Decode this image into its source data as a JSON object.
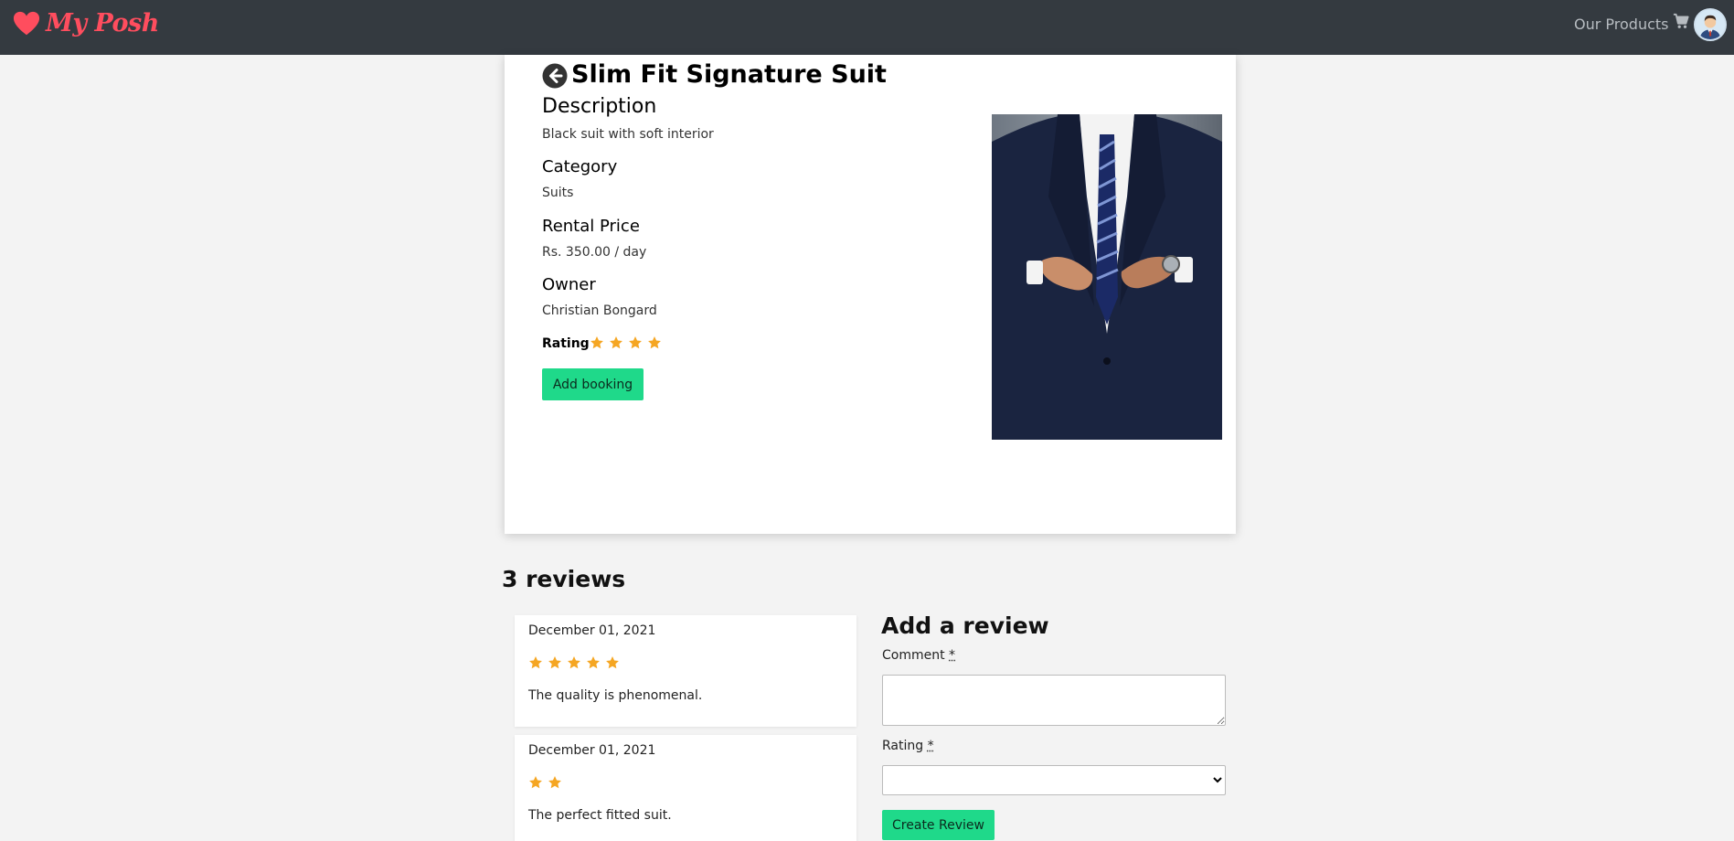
{
  "navbar": {
    "brand": "My Posh",
    "brand_color": "#ff4d5e",
    "links": [
      {
        "label": "Our Products"
      }
    ],
    "icons": [
      "heart-icon",
      "cart-icon",
      "user-avatar"
    ]
  },
  "product": {
    "title": "Slim Fit Signature Suit",
    "description_heading": "Description",
    "description": "Black suit with soft interior",
    "category_heading": "Category",
    "category": "Suits",
    "price_heading": "Rental Price",
    "price": "Rs. 350.00 / day",
    "owner_heading": "Owner",
    "owner": "Christian Bongard",
    "rating_label": "Rating",
    "rating": 4,
    "add_booking_label": "Add booking",
    "image_alt": "man in navy suit"
  },
  "reviews": {
    "count_label": "3 reviews",
    "items": [
      {
        "date": "December 01, 2021",
        "rating": 5,
        "text": "The quality is phenomenal."
      },
      {
        "date": "December 01, 2021",
        "rating": 2,
        "text": "The perfect fitted suit."
      }
    ]
  },
  "review_form": {
    "title": "Add a review",
    "comment_label": "Comment",
    "rating_label": "Rating",
    "required_mark": "*",
    "comment_value": "",
    "rating_selected": "",
    "submit_label": "Create Review"
  },
  "colors": {
    "navbar_bg": "#343a40",
    "accent_green": "#1fd98a",
    "star": "#f5a623",
    "page_bg": "#f3f3f3"
  }
}
